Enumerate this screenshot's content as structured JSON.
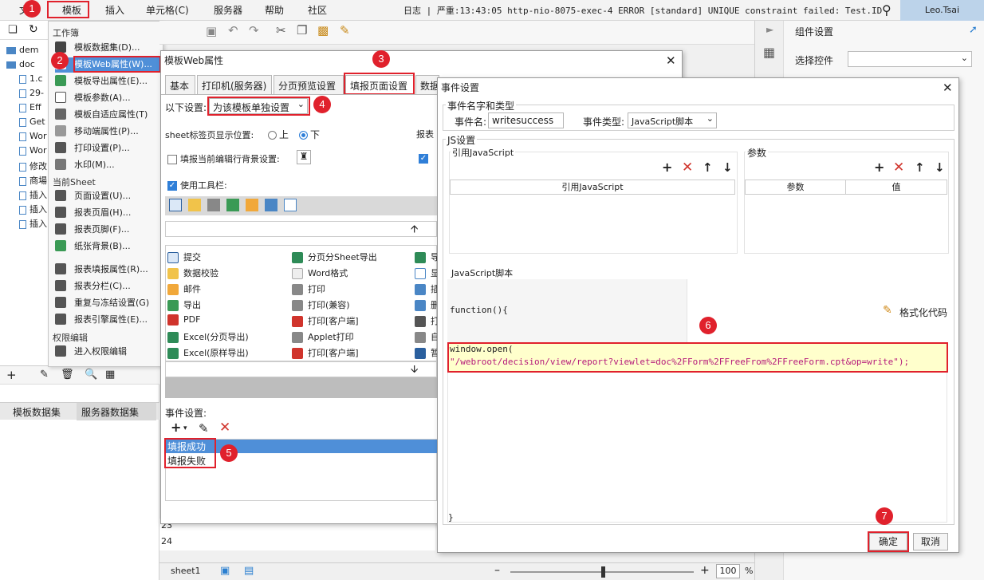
{
  "menubar": {
    "items": [
      "文",
      "模板",
      "插入",
      "单元格(C)",
      "服务器",
      "帮助",
      "社区"
    ],
    "log_text": "日志 | 严重:13:43:05 http-nio-8075-exec-4 ERROR [standard] UNIQUE constraint failed: Test.ID",
    "user": "Leo.Tsai"
  },
  "badges": [
    "1",
    "2",
    "3",
    "4",
    "5",
    "6",
    "7"
  ],
  "left_tree": {
    "items": [
      "dem",
      "doc",
      "1.c",
      "29-",
      "Eff",
      "Get",
      "Wor",
      "Wor",
      "修改",
      "商場",
      "插入",
      "插入",
      "插入"
    ]
  },
  "template_menu": {
    "section_workbook": "工作簿",
    "workbook_items": [
      "模板数据集(D)...",
      "模板Web属性(W)...",
      "模板导出属性(E)...",
      "模板参数(A)...",
      "模板自适应属性(T)",
      "移动端属性(P)...",
      "打印设置(P)...",
      "水印(M)..."
    ],
    "section_sheet": "当前Sheet",
    "sheet_items": [
      "页面设置(U)...",
      "报表页眉(H)...",
      "报表页脚(F)...",
      "纸张背景(B)...",
      "报表填报属性(R)...",
      "报表分栏(C)...",
      "重复与冻结设置(G)",
      "报表引擎属性(E)..."
    ],
    "section_perm": "权限编辑",
    "perm_items": [
      "进入权限编辑"
    ]
  },
  "bottom_left_tabs": [
    "模板数据集",
    "服务器数据集"
  ],
  "right_panel": {
    "title": "组件设置",
    "select_label": "选择控件"
  },
  "web_dialog": {
    "title": "模板Web属性",
    "tabs": [
      "基本",
      "打印机(服务器)",
      "分页预览设置",
      "填报页面设置",
      "数据"
    ],
    "setting_label": "以下设置:",
    "setting_value": "为该模板单独设置",
    "sheet_tab_label": "sheet标签页显示位置:",
    "radio_top": "上",
    "radio_bottom": "下",
    "report_label": "报表",
    "fill_bg_label": "填报当前编辑行背景设置:",
    "use_toolbar_label": "使用工具栏:",
    "tools_col1": [
      "提交",
      "数据校验",
      "邮件",
      "导出",
      "PDF",
      "Excel(分页导出)",
      "Excel(原样导出)"
    ],
    "tools_col2": [
      "分页分Sheet导出",
      "Word格式",
      "打印",
      "打印(兼容)",
      "打印[客户端]",
      "Applet打印",
      "打印[客户端]"
    ],
    "tools_col3": [
      "导",
      "显",
      "插",
      "删",
      "打",
      "自",
      "暂"
    ],
    "event_label": "事件设置:",
    "events": [
      "填报成功",
      "填报失败"
    ]
  },
  "event_dialog": {
    "title": "事件设置",
    "section_name_type": "事件名字和类型",
    "event_name_label": "事件名:",
    "event_name_value": "writesuccess",
    "event_type_label": "事件类型:",
    "event_type_value": "JavaScript脚本",
    "js_section": "JS设置",
    "ref_js_label": "引用JavaScript",
    "ref_js_col": "引用JavaScript",
    "params_label": "参数",
    "params_cols": [
      "参数",
      "值"
    ],
    "script_label": "JavaScript脚本",
    "format_code": "格式化代码",
    "code_line1": "function(){",
    "code_line2": "window.open(",
    "code_line3": "\"/webroot/decision/view/report?viewlet=doc%2FForm%2FFreeFrom%2FFreeForm.cpt&op=write\");",
    "code_end": "}",
    "ok": "确定",
    "cancel": "取消"
  },
  "status": {
    "sheet": "sheet1",
    "zoom": "100",
    "zoom_unit": "%",
    "row_a": "23",
    "row_b": "24"
  }
}
